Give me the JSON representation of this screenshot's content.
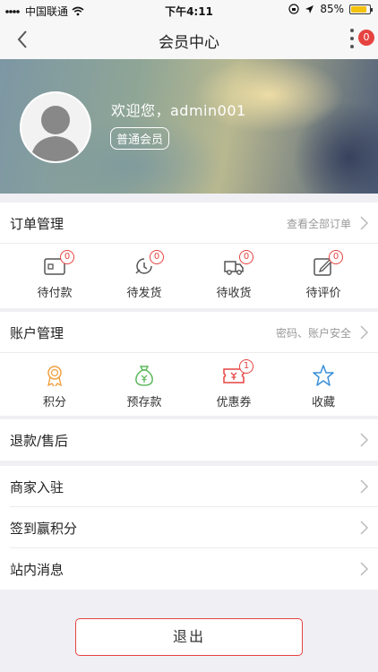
{
  "status_bar": {
    "carrier": "中国联通",
    "time": "下午4:11",
    "battery": "85%",
    "battery_level": 0.85
  },
  "nav": {
    "title": "会员中心",
    "badge": "0"
  },
  "profile": {
    "welcome": "欢迎您，admin001",
    "level": "普通会员"
  },
  "orders": {
    "title": "订单管理",
    "link": "查看全部订单",
    "items": [
      {
        "label": "待付款",
        "icon": "wallet-icon",
        "count": "0"
      },
      {
        "label": "待发货",
        "icon": "clock-icon",
        "count": "0"
      },
      {
        "label": "待收货",
        "icon": "truck-icon",
        "count": "0"
      },
      {
        "label": "待评价",
        "icon": "edit-icon",
        "count": "0"
      }
    ]
  },
  "account": {
    "title": "账户管理",
    "link": "密码、账户安全",
    "items": [
      {
        "label": "积分",
        "icon": "medal-icon",
        "color": "#f0a040"
      },
      {
        "label": "预存款",
        "icon": "money-bag-icon",
        "color": "#5cb85c"
      },
      {
        "label": "优惠券",
        "icon": "coupon-icon",
        "color": "#e64340",
        "count": "1"
      },
      {
        "label": "收藏",
        "icon": "star-icon",
        "color": "#3a8fd8"
      }
    ]
  },
  "menu": {
    "refund": "退款/售后",
    "merchant": "商家入驻",
    "checkin": "签到赢积分",
    "messages": "站内消息"
  },
  "logout": "退出",
  "colors": {
    "accent": "#e64340",
    "background": "#efeff4"
  }
}
